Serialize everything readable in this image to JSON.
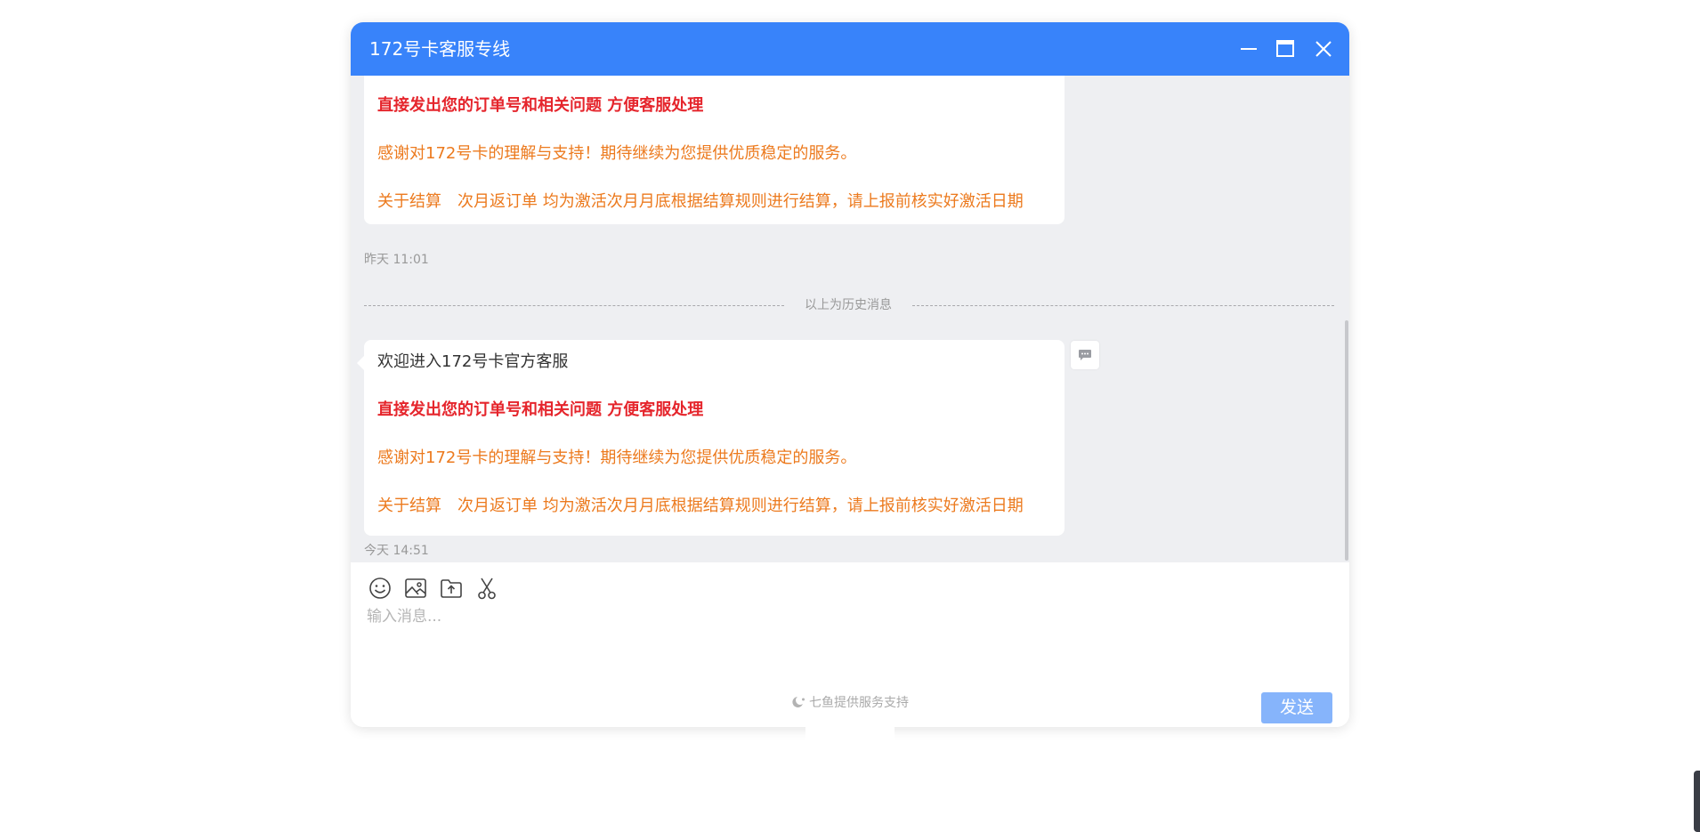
{
  "window": {
    "title": "172号卡客服专线",
    "accent_color": "#3883fa",
    "controls": {
      "minimize_icon": "minimize-icon",
      "maximize_icon": "maximize-icon",
      "close_icon": "close-icon"
    }
  },
  "messages": [
    {
      "lines": [
        {
          "text": "直接发出您的订单号和相关问题 方便客服处理",
          "style": "red"
        },
        {
          "text": "感谢对172号卡的理解与支持！期待继续为您提供优质稳定的服务。",
          "style": "orange"
        },
        {
          "text": "关于结算　次月返订单 均为激活次月月底根据结算规则进行结算，请上报前核实好激活日期",
          "style": "orange"
        }
      ],
      "time": "昨天 11:01"
    },
    {
      "lines": [
        {
          "text": "欢迎进入172号卡官方客服",
          "style": "plain"
        },
        {
          "text": "直接发出您的订单号和相关问题 方便客服处理",
          "style": "red"
        },
        {
          "text": "感谢对172号卡的理解与支持！期待继续为您提供优质稳定的服务。",
          "style": "orange"
        },
        {
          "text": "关于结算　次月返订单 均为激活次月月底根据结算规则进行结算，请上报前核实好激活日期",
          "style": "orange"
        }
      ],
      "time": "今天 14:51"
    }
  ],
  "history_divider": "以上为历史消息",
  "toolbar": {
    "emoji_icon": "emoji-icon",
    "image_icon": "image-icon",
    "file_upload_icon": "file-upload-icon",
    "screenshot_icon": "scissors-icon"
  },
  "input": {
    "placeholder": "输入消息...",
    "value": ""
  },
  "send_label": "发送",
  "footer": "七鱼提供服务支持",
  "colors": {
    "red_text": "#e5252c",
    "orange_text": "#ec7a1e",
    "send_button": "#86b4fb",
    "chat_background": "#eeeff2"
  }
}
